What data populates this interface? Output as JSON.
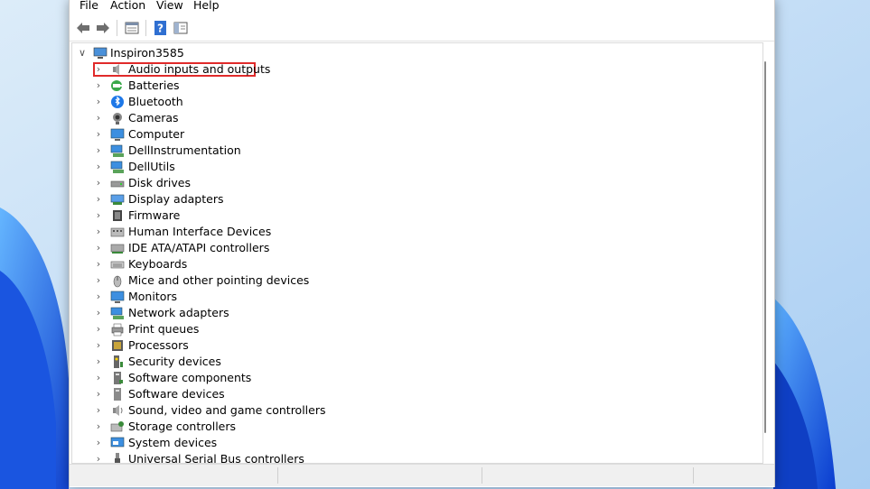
{
  "menu": [
    "File",
    "Action",
    "View",
    "Help"
  ],
  "toolbar": [
    "back-icon",
    "forward-icon",
    "properties-icon",
    "help-icon",
    "show-hide-console-tree-icon"
  ],
  "tree": {
    "root": "Inspiron3585",
    "categories": [
      "Audio inputs and outputs",
      "Batteries",
      "Bluetooth",
      "Cameras",
      "Computer",
      "DellInstrumentation",
      "DellUtils",
      "Disk drives",
      "Display adapters",
      "Firmware",
      "Human Interface Devices",
      "IDE ATA/ATAPI controllers",
      "Keyboards",
      "Mice and other pointing devices",
      "Monitors",
      "Network adapters",
      "Print queues",
      "Processors",
      "Security devices",
      "Software components",
      "Software devices",
      "Sound, video and game controllers",
      "Storage controllers",
      "System devices",
      "Universal Serial Bus controllers"
    ],
    "highlighted": "Audio inputs and outputs"
  },
  "colors": {
    "wallpaper": "#1e5fd6",
    "wallpaper_light": "#cfe6fb",
    "highlight_box": "#e02a2a"
  }
}
